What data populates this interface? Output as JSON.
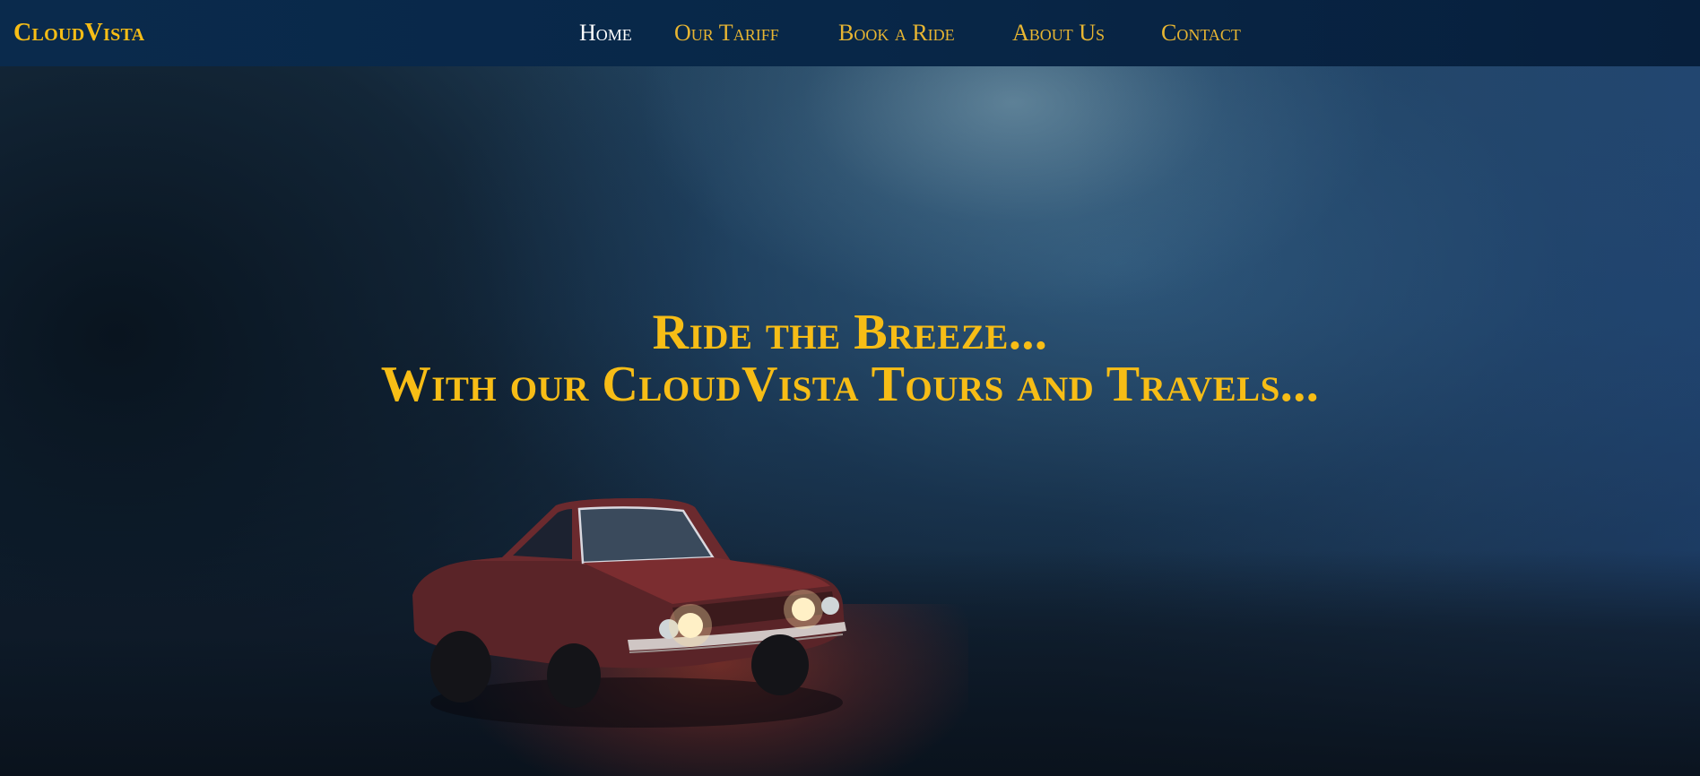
{
  "brand": {
    "name": "CloudVista"
  },
  "nav": {
    "items": [
      {
        "label": "Home",
        "active": true
      },
      {
        "label": "Our Tariff",
        "active": false
      },
      {
        "label": "Book a Ride",
        "active": false
      },
      {
        "label": "About Us",
        "active": false
      },
      {
        "label": "Contact",
        "active": false
      }
    ]
  },
  "hero": {
    "line1": "Ride the Breeze...",
    "line2": "With our CloudVista Tours and Travels..."
  },
  "colors": {
    "accent": "#f7bd16",
    "nav_background": "#082748",
    "active_link": "#ffffff"
  }
}
